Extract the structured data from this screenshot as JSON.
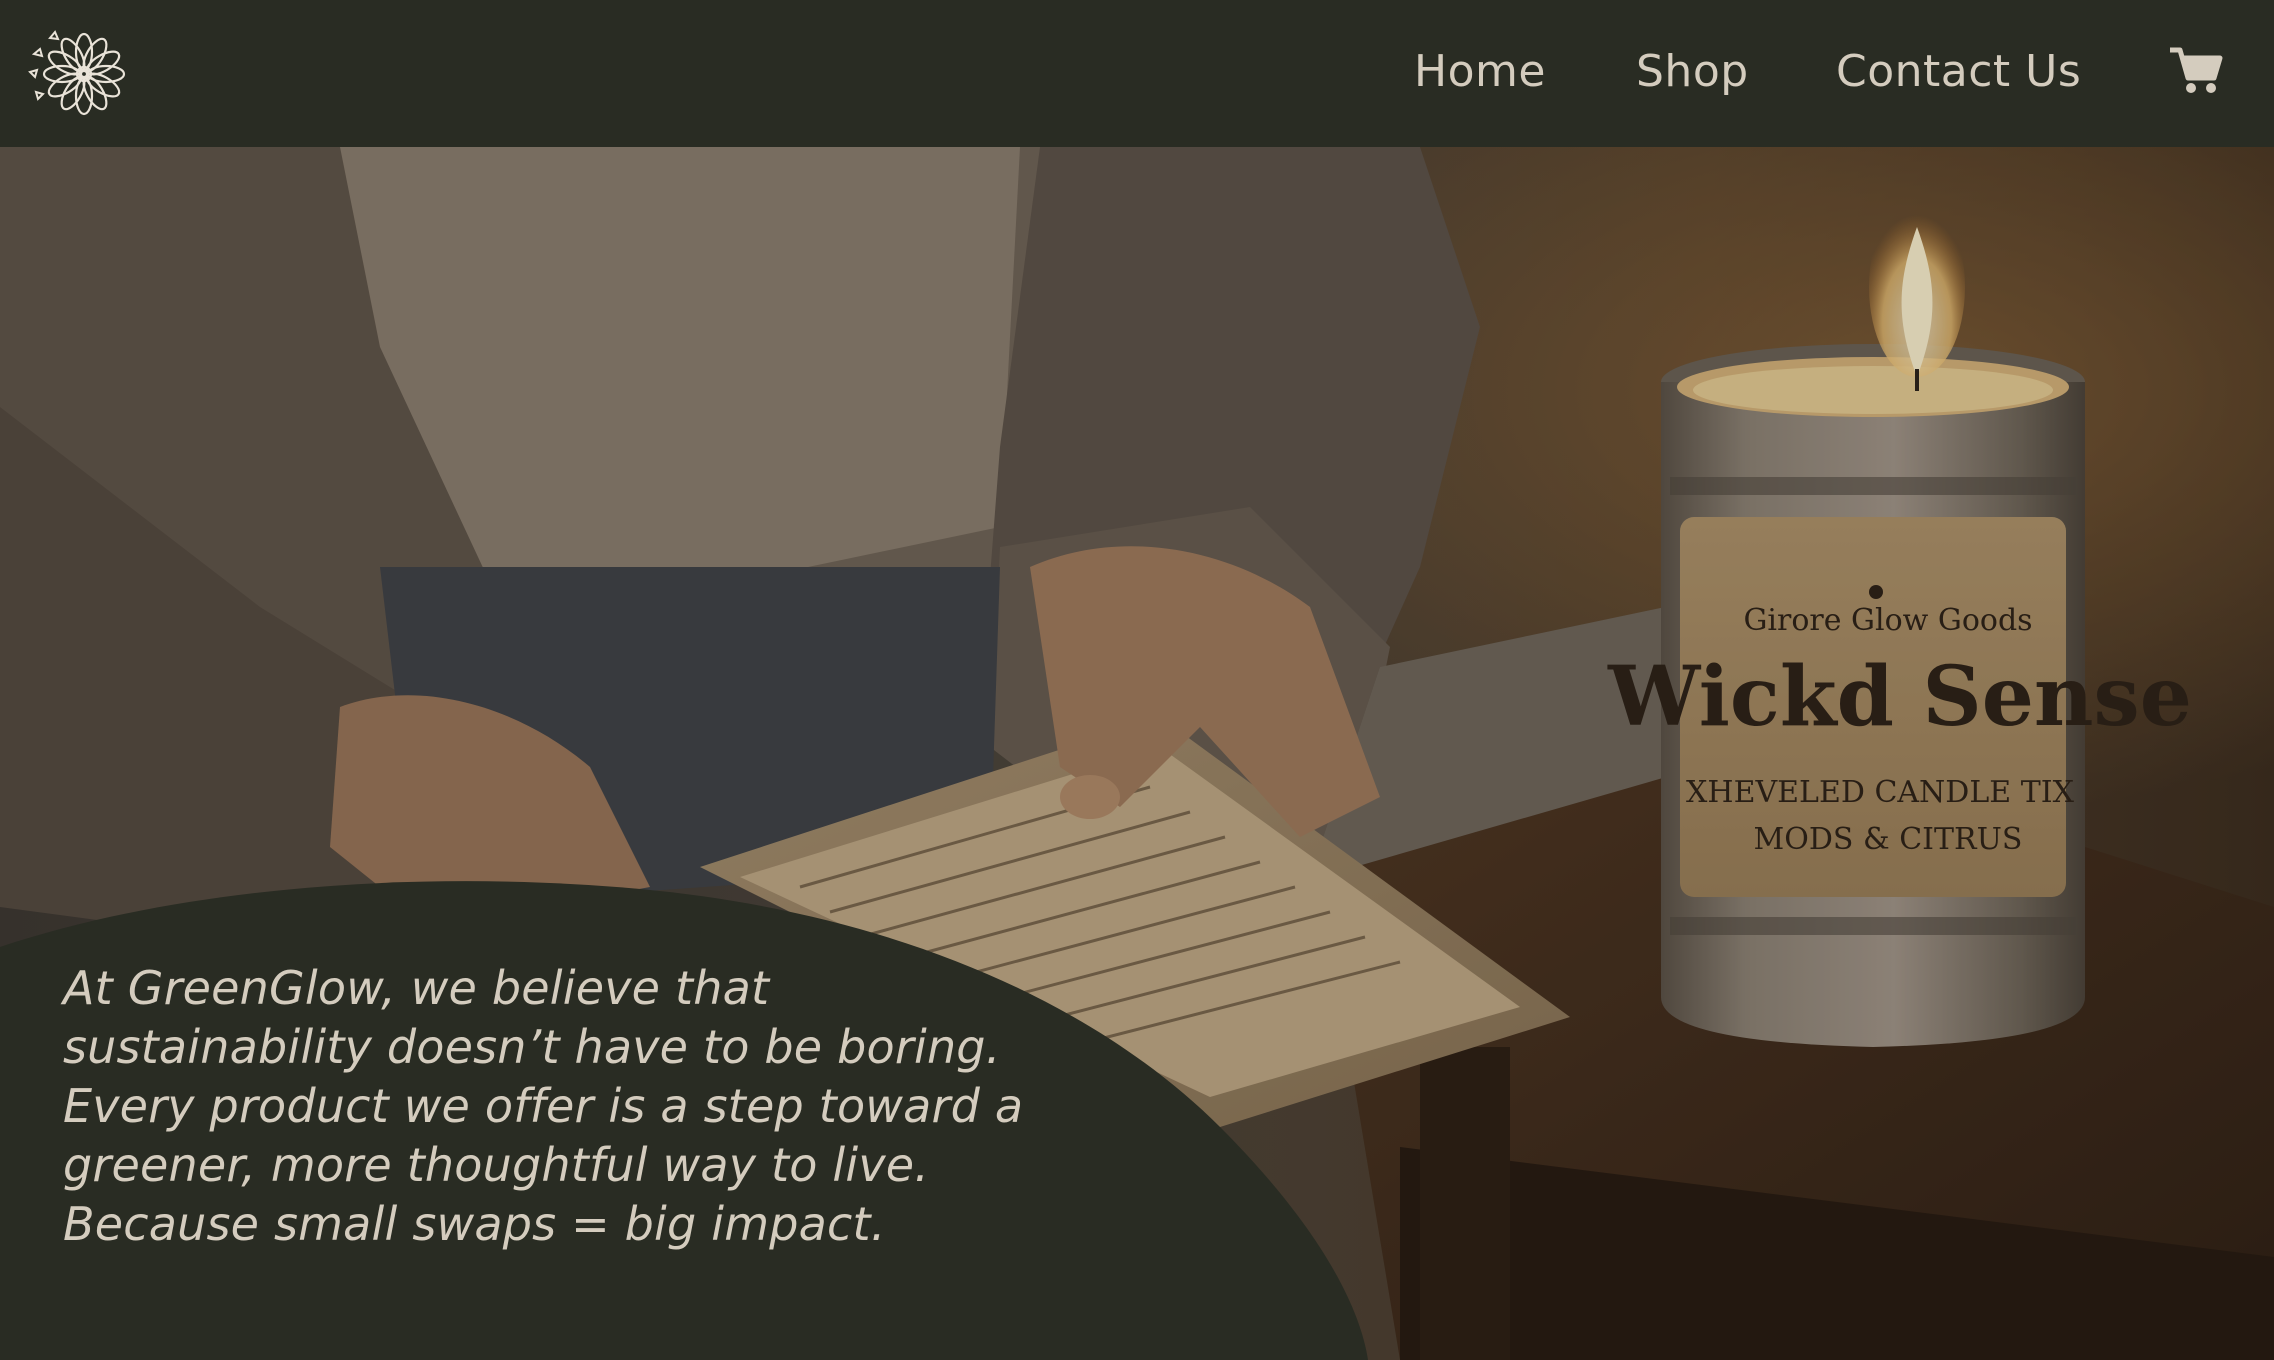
{
  "header": {
    "logo_icon": "flower-icon",
    "nav": [
      {
        "label": "Home"
      },
      {
        "label": "Shop"
      },
      {
        "label": "Contact Us"
      }
    ],
    "cart_icon": "cart-icon"
  },
  "hero": {
    "tagline": "At GreenGlow, we believe that sustainability doesn’t have to be boring. Every product we offer is a step toward a greener, more thoughtful way to live. Because small swaps = big impact.",
    "candle_label": {
      "brand": "Girore Glow Goods",
      "name": "Wickd Sense",
      "line1": "XHEVELED CANDLE TIX",
      "line2": "MODS & CITRUS"
    }
  },
  "colors": {
    "header_bg": "#292c23",
    "text": "#d4ccbe",
    "panel": "#292c23"
  }
}
